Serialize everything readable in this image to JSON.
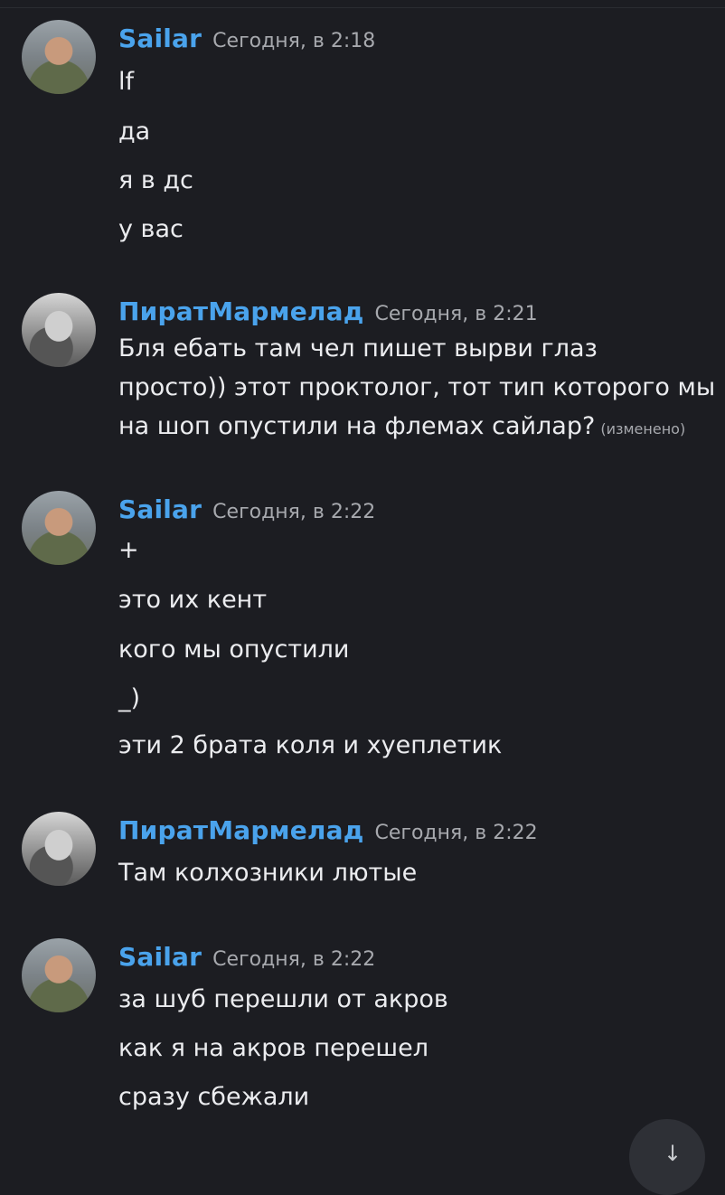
{
  "messages": [
    {
      "author": "Sailar",
      "time": "Сегодня, в 2:18",
      "lines": [
        "lf",
        "да",
        "я в дс",
        "у вас"
      ]
    },
    {
      "author": "ПиратМармелад",
      "time": "Сегодня, в 2:21",
      "lines": [
        "Бля ебать там чел пишет вырви глаз",
        "просто)) этот проктолог, тот тип которого мы",
        "на шоп опустили на флемах сайлар?"
      ],
      "edited": "(изменено)"
    },
    {
      "author": "Sailar",
      "time": "Сегодня, в 2:22",
      "lines": [
        "+",
        "это их кент",
        "кого мы опустили",
        "_)",
        "эти 2 брата коля и хуеплетик"
      ]
    },
    {
      "author": "ПиратМармелад",
      "time": "Сегодня, в 2:22",
      "lines": [
        "Там колхозники лютые"
      ]
    },
    {
      "author": "Sailar",
      "time": "Сегодня, в 2:22",
      "lines": [
        "за шуб перешли от акров",
        "как я на акров перешел",
        "сразу сбежали"
      ]
    }
  ],
  "icons": {
    "scroll_to_bottom": "arrow-down-icon"
  }
}
